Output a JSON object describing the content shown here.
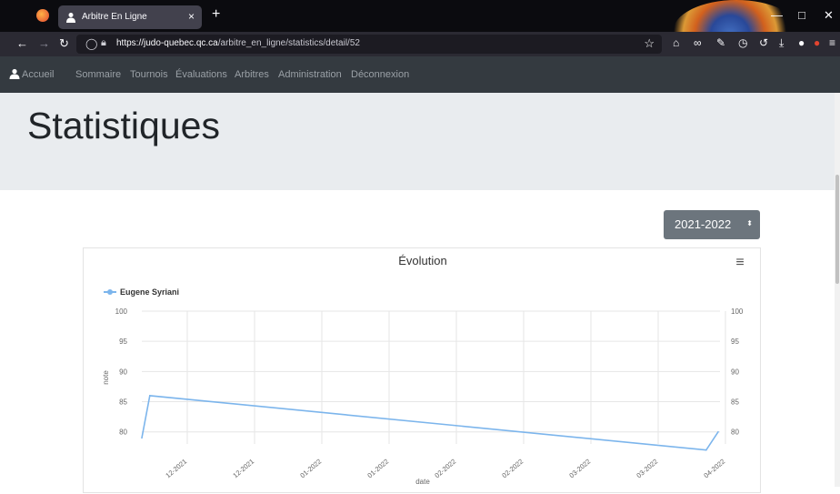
{
  "browser": {
    "tab_title": "Arbitre En Ligne",
    "tab_close": "×",
    "new_tab": "+",
    "url_host": "https://judo-quebec.qc.ca",
    "url_path": "/arbitre_en_ligne/statistics/detail/52",
    "minimize": "—",
    "maximize": "□",
    "close": "✕"
  },
  "nav": {
    "items": [
      {
        "label": "Accueil"
      },
      {
        "label": "Sommaire"
      },
      {
        "label": "Tournois"
      },
      {
        "label": "Évaluations"
      },
      {
        "label": "Arbitres"
      },
      {
        "label": "Administration"
      },
      {
        "label": "Déconnexion"
      }
    ]
  },
  "page": {
    "title": "Statistiques"
  },
  "season_select": {
    "value": "2021-2022",
    "caret": "⬍"
  },
  "chart_data": {
    "type": "line",
    "title": "Évolution",
    "menu_icon": "≡",
    "xlabel": "date",
    "ylabel": "note",
    "ylim": [
      78,
      100
    ],
    "yticks": [
      80,
      85,
      90,
      95,
      100
    ],
    "xticks": [
      "12-2021",
      "12-2021",
      "01-2022",
      "01-2022",
      "02-2022",
      "02-2022",
      "03-2022",
      "03-2022",
      "04-2022"
    ],
    "legend": "top-left",
    "grid": true,
    "series": [
      {
        "name": "Eugene Syriani",
        "color": "#7cb5ec",
        "points": [
          {
            "x": "2021-11-22",
            "y": 79
          },
          {
            "x": "2021-11-24",
            "y": 86
          },
          {
            "x": "2022-04-12",
            "y": 77
          },
          {
            "x": "2022-04-15",
            "y": 80
          }
        ]
      }
    ]
  }
}
